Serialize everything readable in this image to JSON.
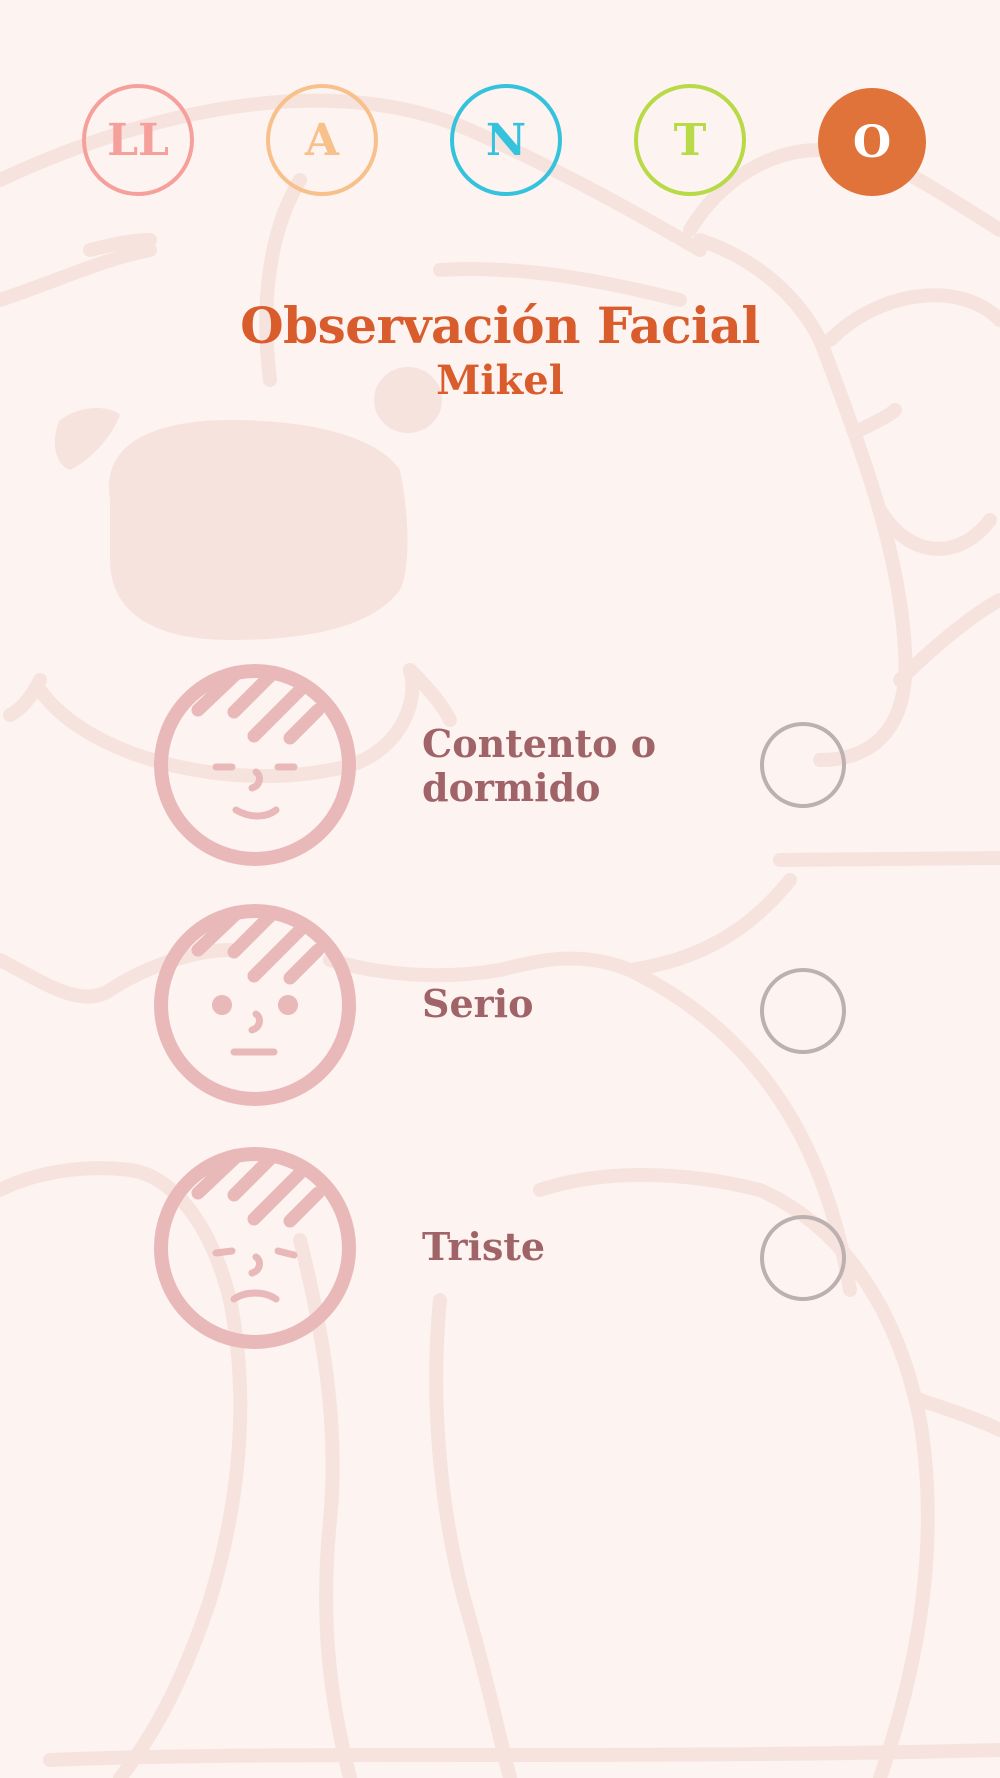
{
  "colors": {
    "background": "#fdf3f1",
    "background_art": "#f7e3de",
    "title": "#d85c2c",
    "option_text": "#a06468",
    "face": "#e9b8b8",
    "radio_border": "#bcb0b1"
  },
  "steps": [
    {
      "label": "LL",
      "color": "#f6a09c",
      "filled": false
    },
    {
      "label": "A",
      "color": "#f8c08a",
      "filled": false
    },
    {
      "label": "N",
      "color": "#35c2dc",
      "filled": false
    },
    {
      "label": "T",
      "color": "#b8da46",
      "filled": false
    },
    {
      "label": "O",
      "color": "#e0733a",
      "filled": true,
      "active": true
    }
  ],
  "header": {
    "title": "Observación Facial",
    "subtitle": "Mikel"
  },
  "options": [
    {
      "label": "Contento o dormido",
      "icon": "content-face-icon",
      "selected": false
    },
    {
      "label": "Serio",
      "icon": "serious-face-icon",
      "selected": false
    },
    {
      "label": "Triste",
      "icon": "sad-face-icon",
      "selected": false
    }
  ]
}
